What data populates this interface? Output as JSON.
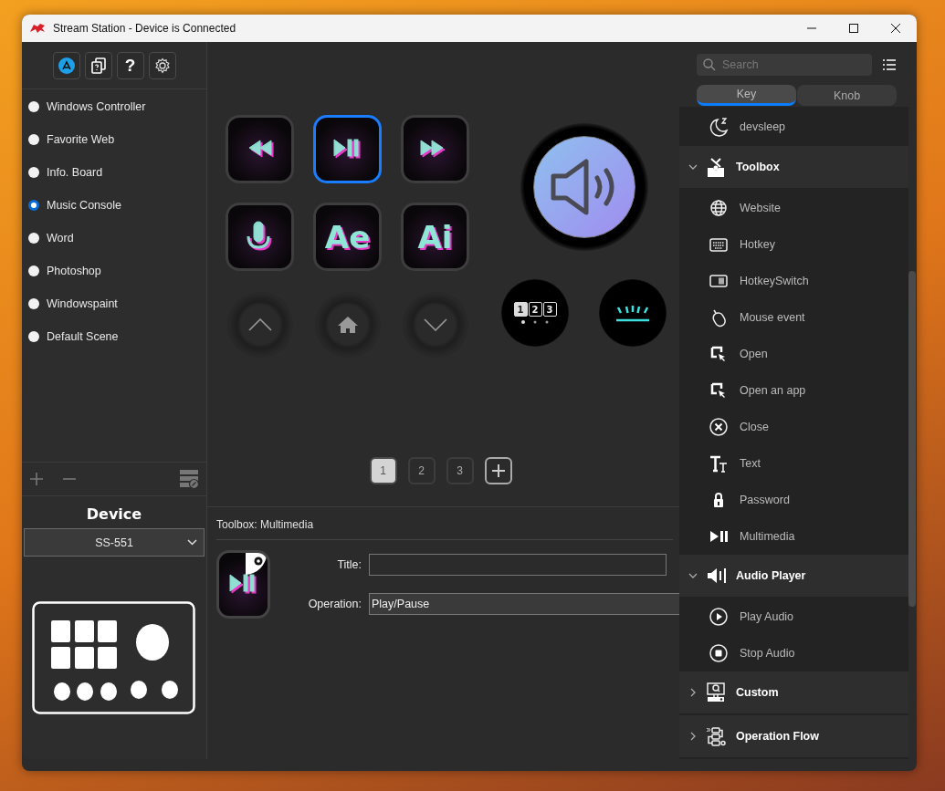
{
  "window": {
    "title": "Stream Station - Device is Connected"
  },
  "toolbar": {
    "help_label": "?"
  },
  "scenes": [
    {
      "label": "Windows Controller",
      "selected": false
    },
    {
      "label": "Favorite Web",
      "selected": false
    },
    {
      "label": "Info. Board",
      "selected": false
    },
    {
      "label": "Music Console",
      "selected": true
    },
    {
      "label": "Word",
      "selected": false
    },
    {
      "label": "Photoshop",
      "selected": false
    },
    {
      "label": "Windowspaint",
      "selected": false
    },
    {
      "label": "Default Scene",
      "selected": false
    }
  ],
  "device": {
    "label": "Device",
    "model": "SS-551"
  },
  "keys": [
    {
      "kind": "rewind",
      "selected": false
    },
    {
      "kind": "play-pause",
      "selected": true
    },
    {
      "kind": "forward",
      "selected": false
    },
    {
      "kind": "mic",
      "selected": false
    },
    {
      "kind": "text",
      "text": "Ae",
      "selected": false
    },
    {
      "kind": "text",
      "text": "Ai",
      "selected": false
    }
  ],
  "knob_buttons": [
    {
      "kind": "up"
    },
    {
      "kind": "home"
    },
    {
      "kind": "down"
    }
  ],
  "page_dial": {
    "labels": [
      "1",
      "2",
      "3"
    ]
  },
  "pages": [
    {
      "label": "1",
      "selected": true
    },
    {
      "label": "2",
      "selected": false
    },
    {
      "label": "3",
      "selected": false
    }
  ],
  "properties": {
    "heading": "Toolbox: Multimedia",
    "title_label": "Title:",
    "operation_label": "Operation:",
    "operation_value": "Play/Pause"
  },
  "actions": {
    "search": {
      "placeholder": "Search"
    },
    "tabs": [
      {
        "label": "Key",
        "selected": true
      },
      {
        "label": "Knob",
        "selected": false
      }
    ],
    "items": [
      {
        "kind": "item",
        "label": "devsleep"
      },
      {
        "kind": "group",
        "label": "Toolbox",
        "expanded": true,
        "children": [
          {
            "label": "Website"
          },
          {
            "label": "Hotkey"
          },
          {
            "label": "HotkeySwitch"
          },
          {
            "label": "Mouse event"
          },
          {
            "label": "Open"
          },
          {
            "label": "Open an app"
          },
          {
            "label": "Close"
          },
          {
            "label": "Text"
          },
          {
            "label": "Password"
          },
          {
            "label": "Multimedia"
          }
        ]
      },
      {
        "kind": "group",
        "label": "Audio Player",
        "expanded": true,
        "children": [
          {
            "label": "Play Audio"
          },
          {
            "label": "Stop Audio"
          }
        ]
      },
      {
        "kind": "group",
        "label": "Custom",
        "expanded": false
      },
      {
        "kind": "group",
        "label": "Operation Flow",
        "expanded": false
      }
    ]
  }
}
